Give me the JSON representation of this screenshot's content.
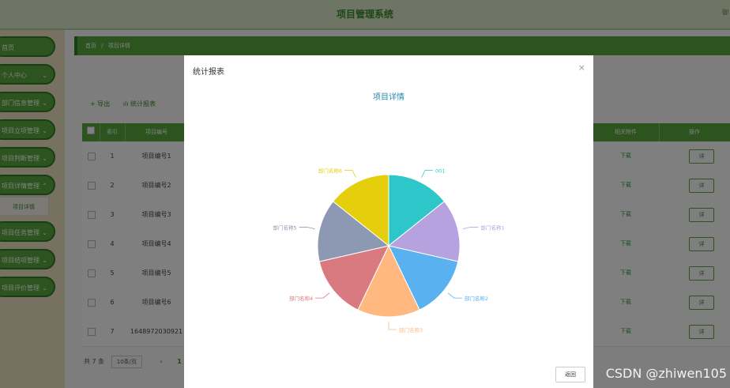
{
  "header": {
    "title": "项目管理系统",
    "user": "御"
  },
  "sidebar": {
    "items": [
      {
        "label": "首页"
      },
      {
        "label": "个人中心"
      },
      {
        "label": "部门信息管理"
      },
      {
        "label": "项目立项管理"
      },
      {
        "label": "项目判断管理"
      },
      {
        "label": "项目详情管理"
      },
      {
        "label": "项目任务管理"
      },
      {
        "label": "项目结项管理"
      },
      {
        "label": "项目评价管理"
      }
    ],
    "subitem": "项目详情"
  },
  "breadcrumb": {
    "home": "首页",
    "sep": "/",
    "current": "项目详情"
  },
  "toolbar": {
    "export": "+ 导出",
    "report": "ılı 统计报表"
  },
  "table": {
    "headers": [
      "",
      "索引",
      "项目编号",
      "相关附件",
      "操作"
    ],
    "rows": [
      {
        "index": "1",
        "code": "项目编号1",
        "attach": "下载",
        "action": "详"
      },
      {
        "index": "2",
        "code": "项目编号2",
        "attach": "下载",
        "action": "详"
      },
      {
        "index": "3",
        "code": "项目编号3",
        "attach": "下载",
        "action": "详"
      },
      {
        "index": "4",
        "code": "项目编号4",
        "attach": "下载",
        "action": "详"
      },
      {
        "index": "5",
        "code": "项目编号5",
        "attach": "下载",
        "action": "详"
      },
      {
        "index": "6",
        "code": "项目编号6",
        "attach": "下载",
        "action": "详"
      },
      {
        "index": "7",
        "code": "1648972030921",
        "attach": "下载",
        "action": "详"
      }
    ]
  },
  "pager": {
    "total": "共 7 条",
    "size": "10条/页",
    "prev": "‹",
    "page": "1"
  },
  "dialog": {
    "title": "统计报表",
    "close": "×",
    "back_label": "返回"
  },
  "chart_data": {
    "type": "pie",
    "title": "项目详情",
    "slices": [
      {
        "label": "001",
        "value": 1,
        "color": "#2ec7c9"
      },
      {
        "label": "部门名称1",
        "value": 1,
        "color": "#b6a2de"
      },
      {
        "label": "部门名称2",
        "value": 1,
        "color": "#5ab1ef"
      },
      {
        "label": "部门名称3",
        "value": 1,
        "color": "#ffb980"
      },
      {
        "label": "部门名称4",
        "value": 1,
        "color": "#d87a80"
      },
      {
        "label": "部门名称5",
        "value": 1,
        "color": "#8d98b3"
      },
      {
        "label": "部门名称6",
        "value": 1,
        "color": "#e5cf0d"
      }
    ]
  },
  "watermark": "CSDN @zhiwen105",
  "cursor": "⇖"
}
